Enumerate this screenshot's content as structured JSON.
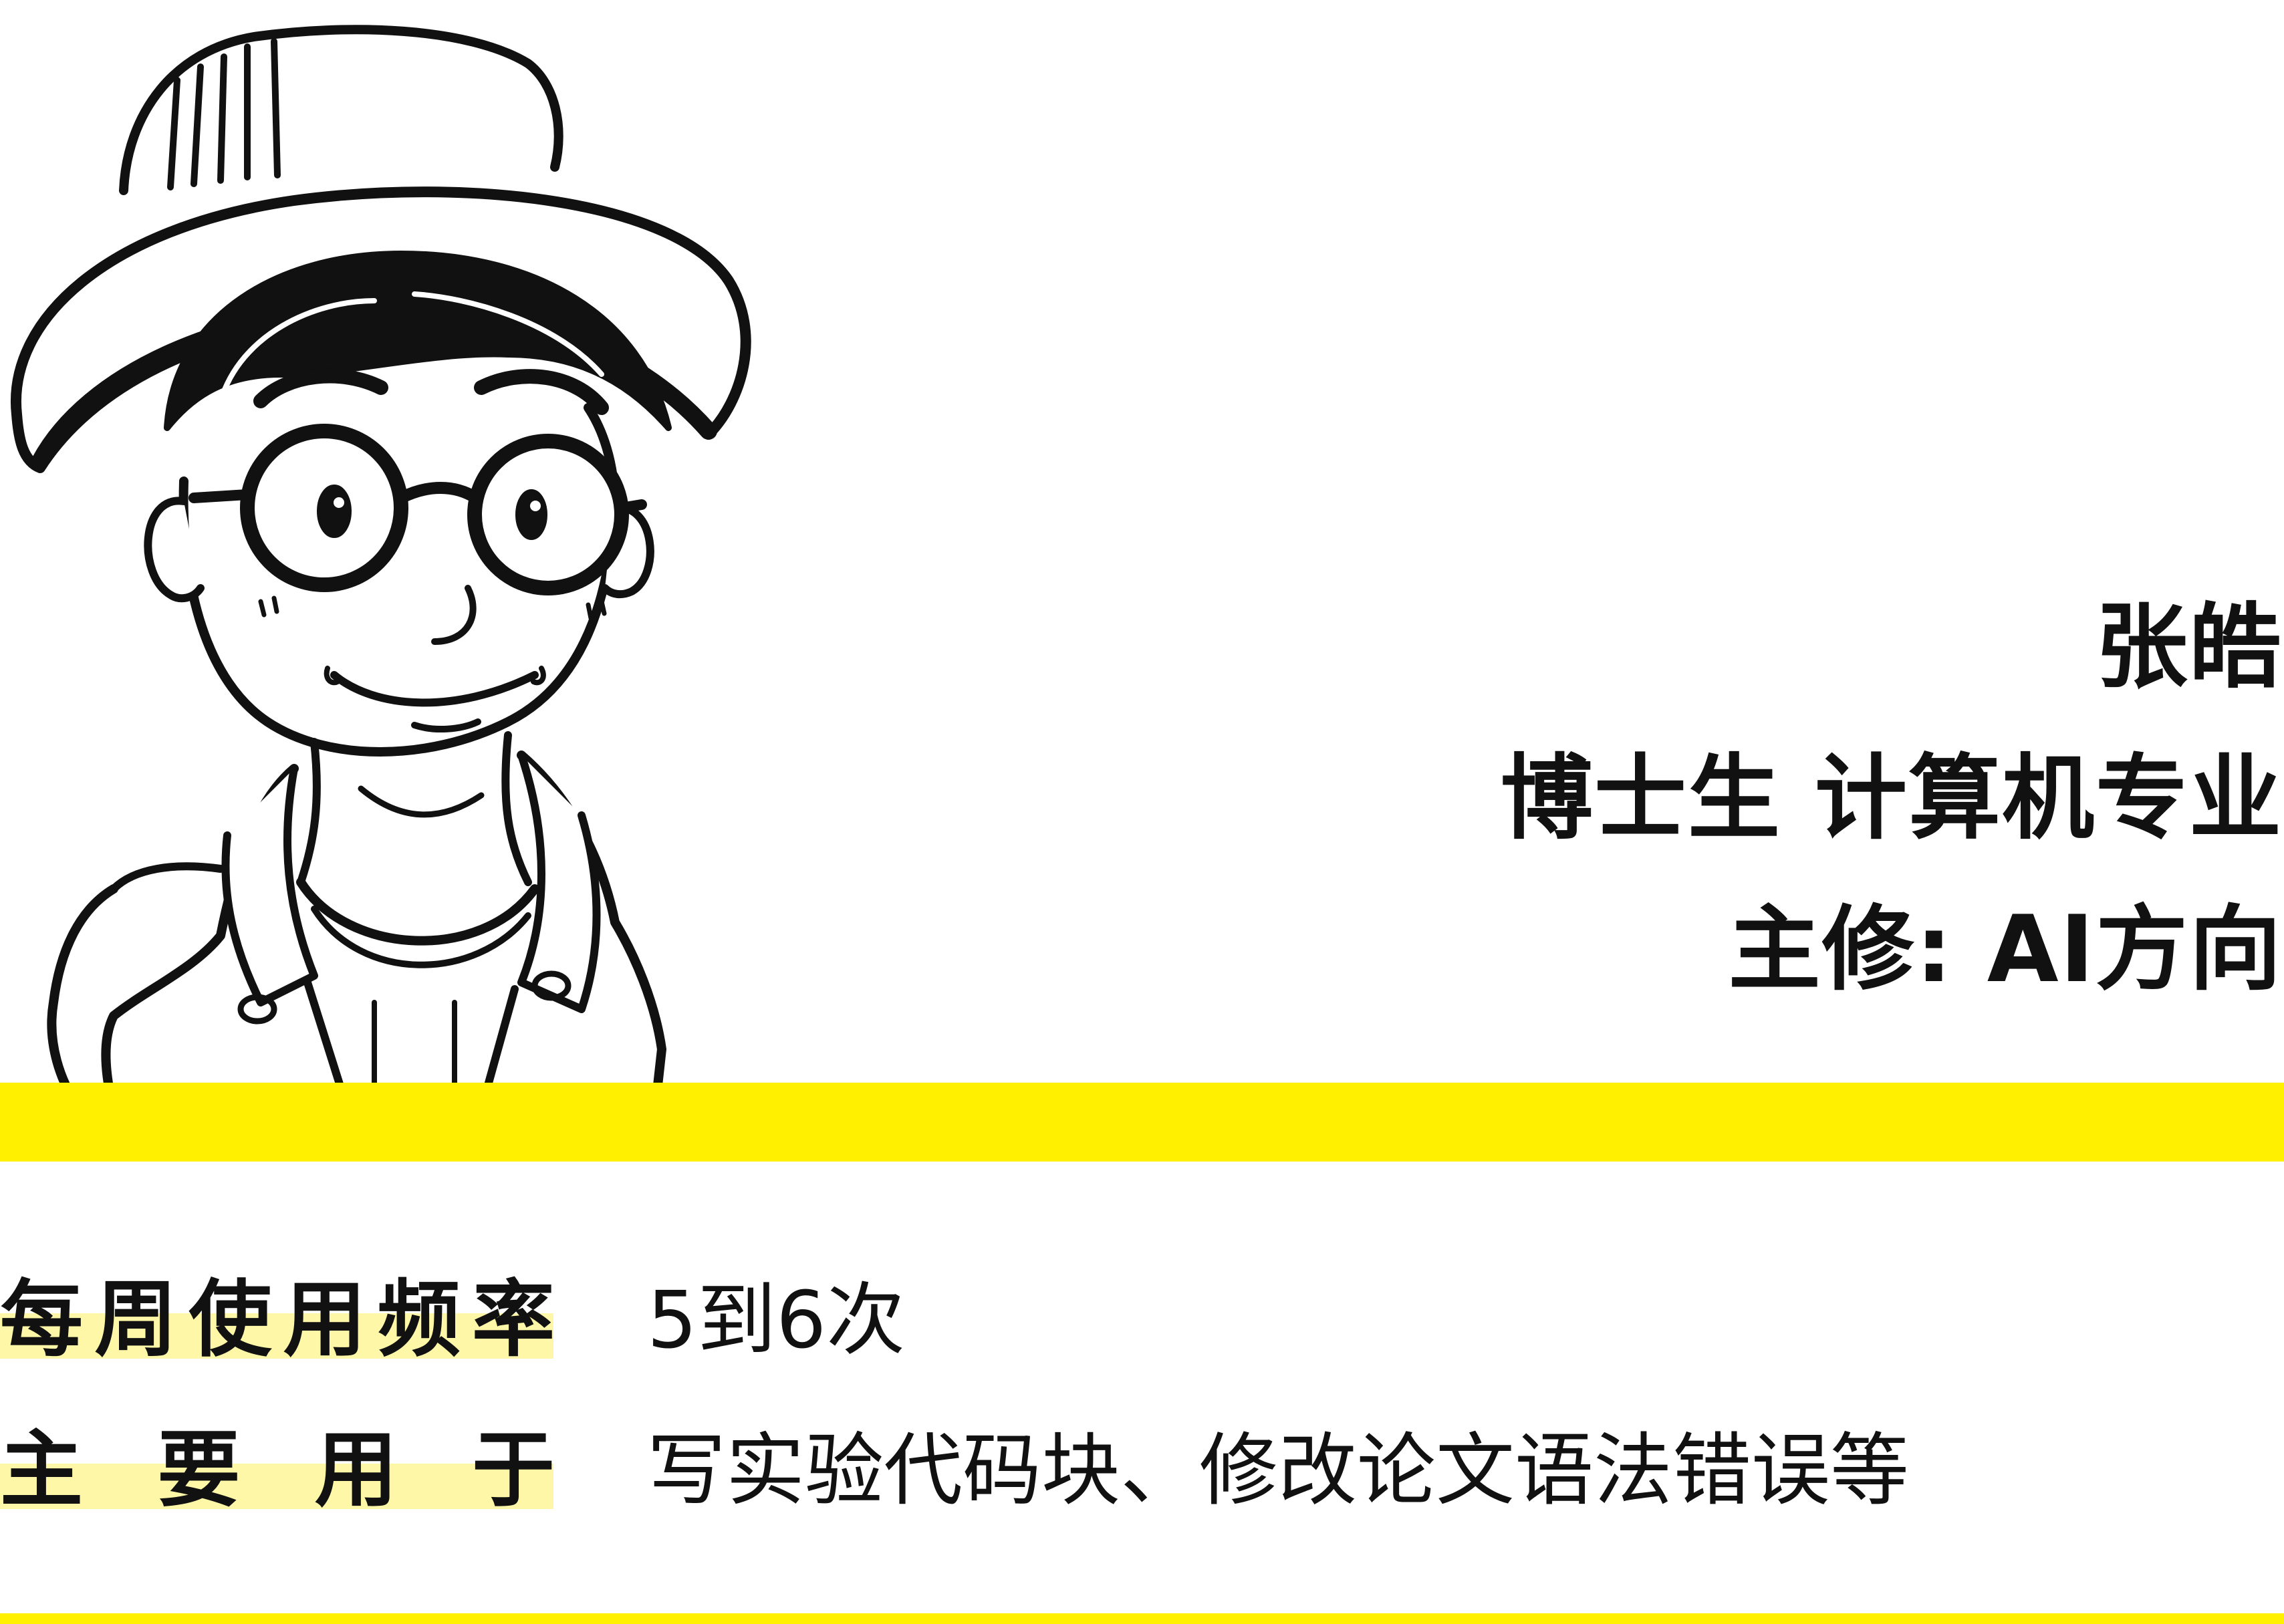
{
  "colors": {
    "accent": "#fff000",
    "highlight": "#fff7a8",
    "ink": "#111111",
    "paper": "#ffffff"
  },
  "portrait": {
    "icon": "cartoon-portrait-hat-glasses"
  },
  "profile": {
    "name": "张皓",
    "role": "博士生  计算机专业",
    "focus": "主修: AI方向"
  },
  "details": [
    {
      "label_chars": [
        "每",
        "周",
        "使",
        "用",
        "频",
        "率"
      ],
      "value": "5到6次"
    },
    {
      "label_chars": [
        "主",
        "要",
        "用",
        "于"
      ],
      "value": "写实验代码块、修改论文语法错误等"
    }
  ]
}
